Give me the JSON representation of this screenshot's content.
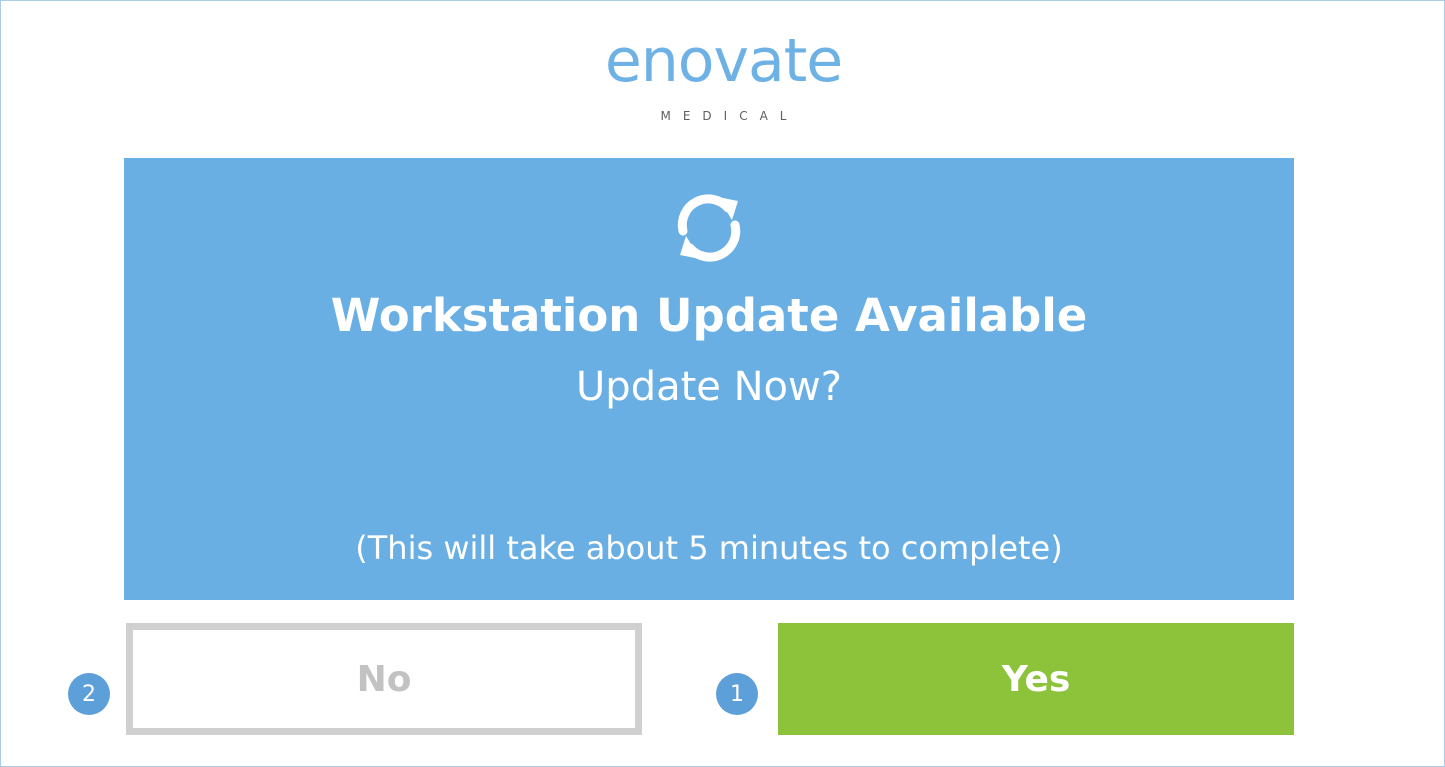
{
  "logo": {
    "wordmark": "enovate",
    "tagline": "MEDICAL"
  },
  "dialog": {
    "icon": "sync-icon",
    "title": "Workstation Update Available",
    "question": "Update Now?",
    "note": "(This will take about 5 minutes to complete)"
  },
  "buttons": {
    "no_label": "No",
    "yes_label": "Yes"
  },
  "badges": {
    "no_step": "2",
    "yes_step": "1"
  },
  "colors": {
    "panel": "#6aafe4",
    "yes": "#8dc33a",
    "no_border": "#d0d0d0",
    "badge": "#5d9fd8",
    "logo": "#6eb1e5"
  }
}
